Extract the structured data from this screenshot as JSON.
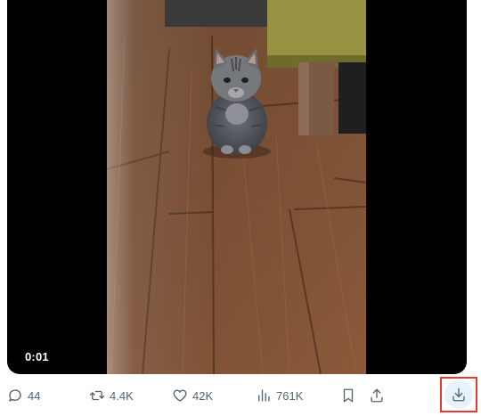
{
  "video": {
    "timestamp": "0:01",
    "content_icon": "kitten-video-frame"
  },
  "actions": {
    "reply": {
      "icon": "comment-icon",
      "count": "44"
    },
    "repost": {
      "icon": "repost-icon",
      "count": "4.4K"
    },
    "like": {
      "icon": "heart-icon",
      "count": "42K"
    },
    "views": {
      "icon": "bar-chart-icon",
      "count": "761K"
    },
    "bookmark": {
      "icon": "bookmark-icon"
    },
    "share": {
      "icon": "share-icon"
    },
    "download": {
      "icon": "download-icon",
      "highlight_color": "#e53935"
    }
  },
  "colors": {
    "icon_gray": "#536471",
    "video_background": "#000000",
    "download_bg": "#e7f3fb"
  }
}
